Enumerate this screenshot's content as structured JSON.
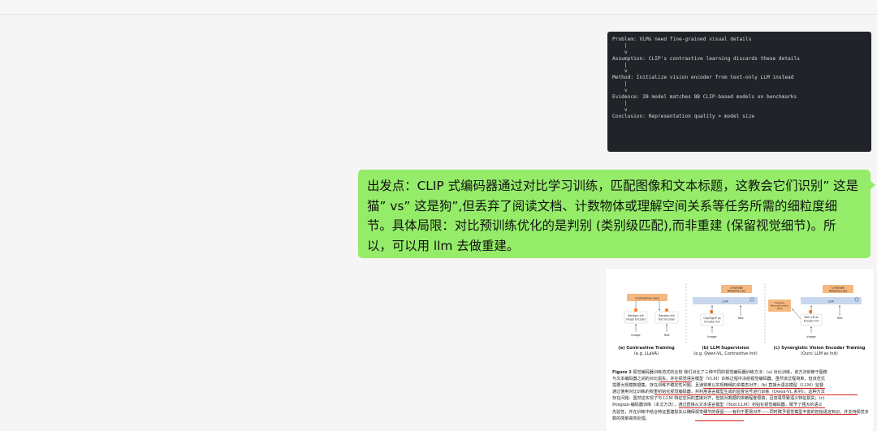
{
  "code_block": {
    "lines": [
      "Problem: VLMs need fine-grained visual details",
      "    |",
      "    v",
      "Assumption: CLIP's contrastive learning discards these details",
      "    |",
      "    v",
      "Method: Initialize vision encoder from text-only LLM instead",
      "    |",
      "    v",
      "Evidence: 2B model matches 8B CLIP-based models on benchmarks",
      "    |",
      "    v",
      "Conclusion: Representation quality > model size"
    ]
  },
  "message": {
    "text": "出发点：CLIP 式编码器通过对比学习训练，匹配图像和文本标题，这教会它们识别” 这是猫” vs” 这是狗”,但丢弃了阅读文档、计数物体或理解空间关系等任务所需的细粒度细节。具体局限：对比预训练优化的是判别 (类别级匹配),而非重建 (保留视觉细节)。所以，可以用 llm 去做重建。"
  },
  "figure": {
    "panel_a": {
      "loss": "Contrastive Loss",
      "image_encoder": "Random-Init Image Encoder",
      "text_encoder": "Random-Init Text Encoder",
      "image": "Image",
      "text": "Text",
      "title": "(a) Contrastive Training",
      "sub": "(e.g. LLaVA)"
    },
    "panel_b": {
      "loss": "Language Modeling Loss",
      "llm": "LLM",
      "encoder": "Clip/SigLIP as Encoder Init",
      "image": "Image",
      "text": "Text",
      "title": "(b) LLM Supervision",
      "sub": "(e.g. Qwen-VL, Contrastive Init)"
    },
    "panel_c": {
      "feature_loss": "Feature Reconstruction Loss",
      "loss": "Language Modeling Loss",
      "llm": "LLM",
      "encoder": "Text LLM as Encoder Init",
      "image": "Image",
      "text": "Text",
      "title": "(c) Synergistic Vision Encoder Training",
      "sub": "(Ours: LLM as Init)"
    },
    "caption_label": "Figure 2",
    "caption_lines": [
      "视觉编码器训练范式的比较  我们对比了三种不同的视觉编码器训练方法：(a) 对比训练，该方法依赖于图像",
      "与文本编码器之间的对比损失，并在视觉语言模型（VLM）训练过程中冻结视觉编码器。虽然该过程简单，但该范式",
      "需要大规模数据集，存在训练不稳定性问题，且通常难以实现精细的多模态对齐；(b) 直接大语言模型（LLM）监督",
      "通过使用对比训练的权重初始化视觉编码器，并利用语言模型生成的监督信号进行训练（Qwen-VL 系列）。这种方法",
      "存在问题：虽然这实现了与 LLM 特征空间的直接对齐，但其对数据的依赖程度很高，且容易导致语义特征损失；(c)",
      "Penguin-编码器训练（本文方法），通过直接从文本语言模型（Text LLM）初始化视觉编码器，赋予了强大的语义",
      "先验性，并在训练中结合特征重建损失以确保视觉细节的保留——有利于更易对齐——同时赋予视觉模型丰富的初始语言知识，并支持视觉多",
      "数的简单高效处理。"
    ]
  },
  "colors": {
    "bubble": "#95ec69",
    "code_bg": "#202327",
    "page_bg": "#f5f5f5",
    "loss_box": "#f5b87e",
    "llm_box": "#c9d7ee"
  }
}
